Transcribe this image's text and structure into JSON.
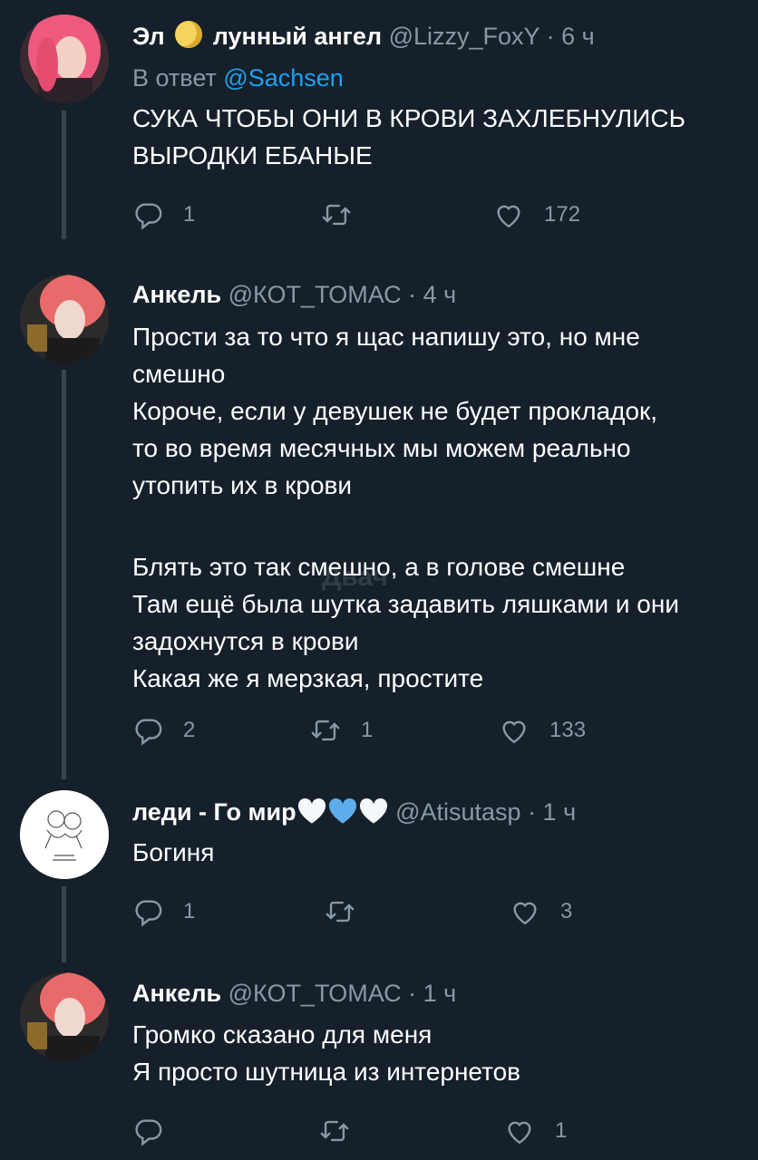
{
  "tweets": [
    {
      "name": "Эл",
      "name_suffix": "лунный ангел",
      "handle": "@Lizzy_FoxY",
      "time": "· 6 ч",
      "reply_prefix": "В ответ",
      "reply_mention": "@Sachsen",
      "lines": [
        "СУКА ЧТОБЫ ОНИ В КРОВИ ЗАХЛЕБНУЛИСЬ",
        "ВЫРОДКИ ЕБАНЫЕ"
      ],
      "replies": "1",
      "retweets": "",
      "likes": "172"
    },
    {
      "name": "Анкель",
      "handle": "@КОТ_ТОМАС",
      "time": "· 4 ч",
      "lines": [
        "Прости за то что я щас напишу это, но мне",
        "смешно",
        "Короче, если у девушек не будет прокладок,",
        "то во время месячных мы можем реально",
        "утопить их в крови",
        "",
        "Блять это так смешно, а в голове смешне",
        "Там ещё была шутка задавить ляшками и они",
        "задохнутся в крови",
        "Какая же я мерзкая, простите"
      ],
      "replies": "2",
      "retweets": "1",
      "likes": "133"
    },
    {
      "name": "леди - Го мир",
      "handle": "@Atisutasp",
      "time": "· 1 ч",
      "lines": [
        "Богиня"
      ],
      "replies": "1",
      "retweets": "",
      "likes": "3"
    },
    {
      "name": "Анкель",
      "handle": "@КОТ_ТОМАС",
      "time": "· 1 ч",
      "lines": [
        "Громко сказано для меня",
        "Я просто шутница из интернетов"
      ],
      "replies": "",
      "retweets": "",
      "likes": "1"
    }
  ],
  "watermark": "Двач",
  "icons": {
    "reply": "reply-icon",
    "retweet": "retweet-icon",
    "like": "heart-icon",
    "moon_emoji": "moon-emoji-icon",
    "hearts_emoji": [
      "white-heart-icon",
      "blue-heart-icon",
      "white-heart-icon"
    ]
  },
  "colors": {
    "background": "#15202b",
    "text": "#ffffff",
    "muted": "#8899a6",
    "link": "#1da1f2",
    "thread_line": "#38444d"
  }
}
